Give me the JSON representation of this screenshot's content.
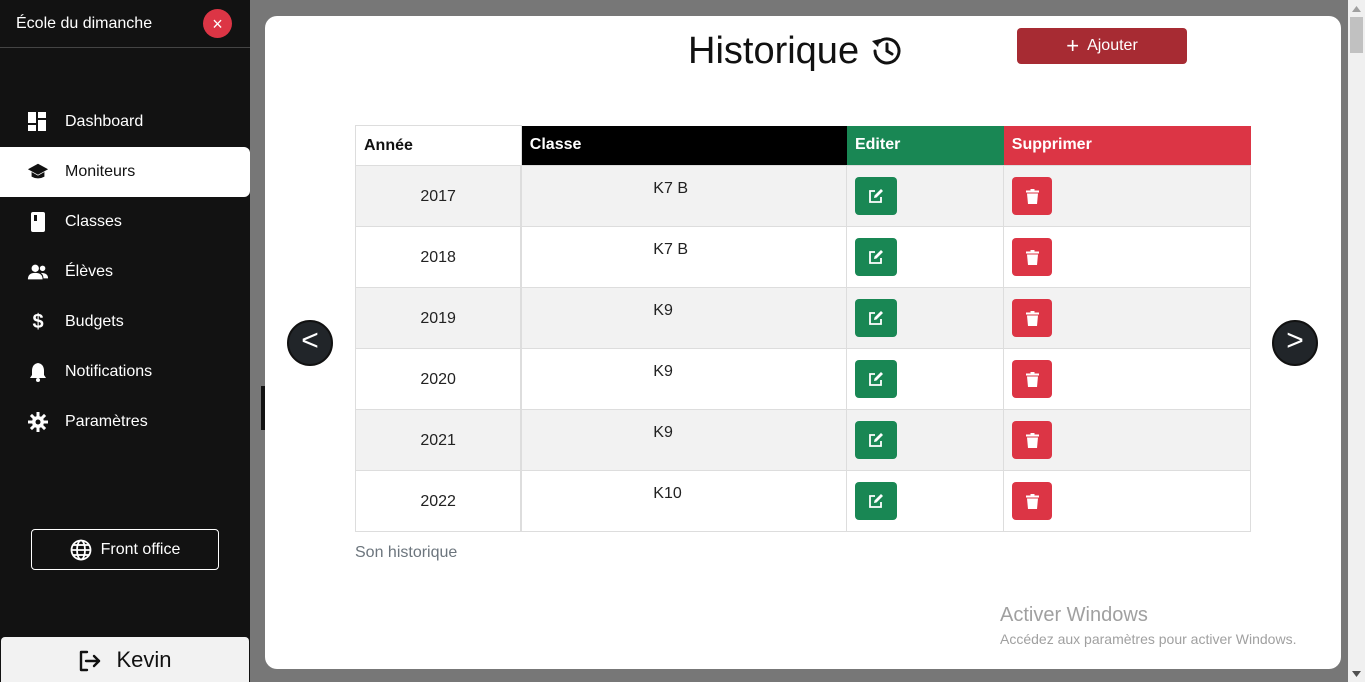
{
  "sidebar": {
    "title": "École du dimanche",
    "close_symbol": "×",
    "items": [
      {
        "label": "Dashboard",
        "icon": "dashboard-icon"
      },
      {
        "label": "Moniteurs",
        "icon": "graduation-cap-icon",
        "active": true
      },
      {
        "label": "Classes",
        "icon": "book-icon"
      },
      {
        "label": "Élèves",
        "icon": "users-icon"
      },
      {
        "label": "Budgets",
        "icon": "dollar-icon"
      },
      {
        "label": "Notifications",
        "icon": "bell-icon"
      },
      {
        "label": "Paramètres",
        "icon": "gear-icon"
      }
    ],
    "front_office": "Front office",
    "user": "Kevin"
  },
  "modal": {
    "title": "Historique",
    "add_label": "Ajouter",
    "prev_label": "<",
    "next_label": ">",
    "table": {
      "headers": [
        "Année",
        "Classe",
        "Editer",
        "Supprimer"
      ],
      "rows": [
        {
          "year": "2017",
          "classe": "K7 B"
        },
        {
          "year": "2018",
          "classe": "K7 B"
        },
        {
          "year": "2019",
          "classe": "K9"
        },
        {
          "year": "2020",
          "classe": "K9"
        },
        {
          "year": "2021",
          "classe": "K9"
        },
        {
          "year": "2022",
          "classe": "K10"
        }
      ]
    },
    "caption": "Son historique"
  },
  "watermark": {
    "title": "Activer Windows",
    "subtitle": "Accédez aux paramètres pour activer Windows."
  },
  "colors": {
    "sidebar_bg": "#121212",
    "danger": "#dc3545",
    "success": "#198754",
    "add_button": "#a72b33"
  }
}
